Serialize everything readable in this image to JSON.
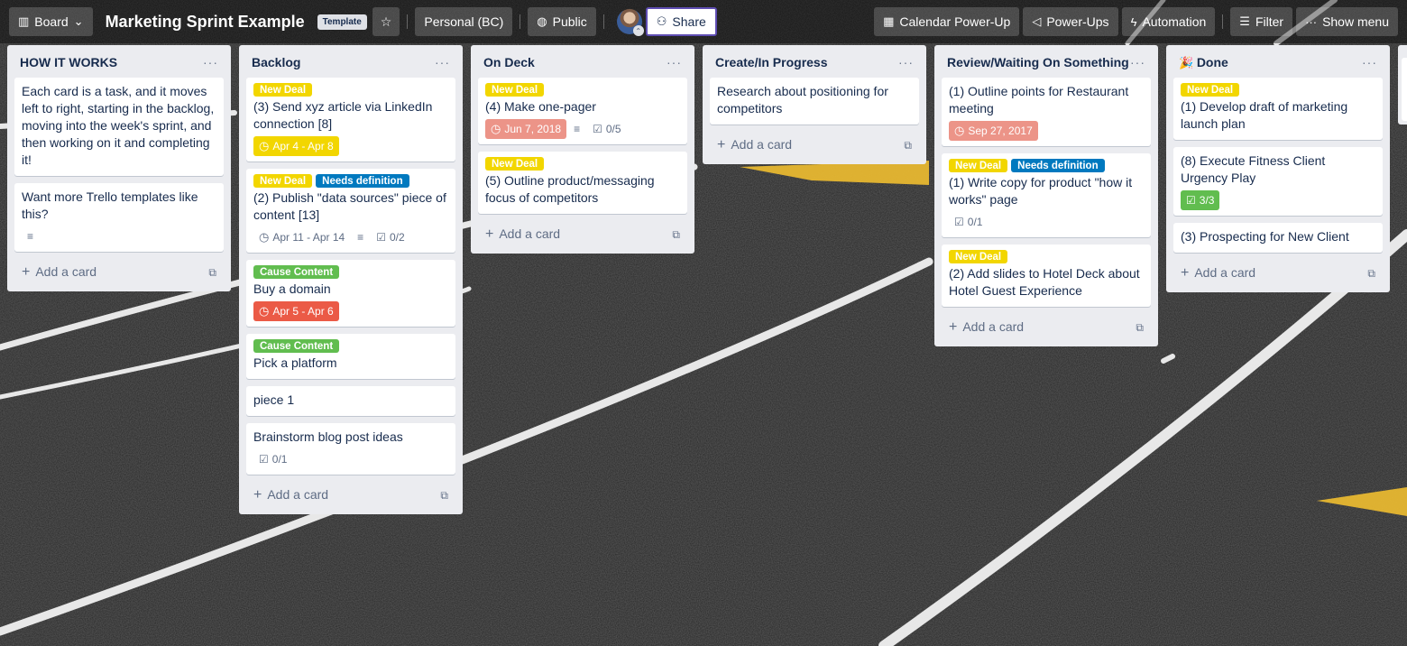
{
  "header": {
    "view_switcher": {
      "icon": "board-icon",
      "label": "Board",
      "chevron": "chevron-down-icon"
    },
    "board_title": "Marketing Sprint Example",
    "template_badge": "Template",
    "star_icon": "star-icon",
    "workspace": "Personal (BC)",
    "visibility": {
      "icon": "globe-icon",
      "label": "Public"
    },
    "share": {
      "icon": "add-member-icon",
      "label": "Share"
    },
    "right_buttons": [
      {
        "name": "calendar-power-up-button",
        "icon": "calendar-icon",
        "glyph": "▦",
        "label": "Calendar Power-Up"
      },
      {
        "name": "power-ups-button",
        "icon": "rocket-icon",
        "glyph": "◁",
        "label": "Power-Ups"
      },
      {
        "name": "automation-button",
        "icon": "lightning-icon",
        "glyph": "ϟ",
        "label": "Automation"
      },
      {
        "name": "filter-button",
        "icon": "filter-icon",
        "glyph": "☰",
        "label": "Filter"
      },
      {
        "name": "show-menu-button",
        "icon": "more-icon",
        "glyph": "···",
        "label": "Show menu"
      }
    ]
  },
  "lists": [
    {
      "title": "HOW IT WORKS",
      "cards": [
        {
          "labels": [],
          "title": "Each card is a task, and it moves left to right, starting in the backlog, moving into the week's sprint, and then working on it and completing it!",
          "badges": []
        },
        {
          "labels": [],
          "title": "Want more Trello templates like this?",
          "badges": [
            {
              "type": "description"
            }
          ]
        }
      ],
      "add_label": "Add a card"
    },
    {
      "title": "Backlog",
      "cards": [
        {
          "labels": [
            {
              "text": "New Deal",
              "color": "yellow"
            }
          ],
          "title": "(3) Send xyz article via LinkedIn connection [8]",
          "badges": [
            {
              "type": "due",
              "text": "Apr 4 - Apr 8",
              "style": "yellow"
            }
          ]
        },
        {
          "labels": [
            {
              "text": "New Deal",
              "color": "yellow"
            },
            {
              "text": "Needs definition",
              "color": "blue"
            }
          ],
          "title": "(2) Publish \"data sources\" piece of content [13]",
          "badges": [
            {
              "type": "due",
              "text": "Apr 11 - Apr 14",
              "style": "plain"
            },
            {
              "type": "description"
            },
            {
              "type": "checklist",
              "text": "0/2"
            }
          ]
        },
        {
          "labels": [
            {
              "text": "Cause Content",
              "color": "green"
            }
          ],
          "title": "Buy a domain",
          "badges": [
            {
              "type": "due",
              "text": "Apr 5 - Apr 6",
              "style": "red"
            }
          ]
        },
        {
          "labels": [
            {
              "text": "Cause Content",
              "color": "green"
            }
          ],
          "title": "Pick a platform",
          "badges": []
        },
        {
          "labels": [],
          "title": "piece 1",
          "badges": []
        },
        {
          "labels": [],
          "title": "Brainstorm blog post ideas",
          "badges": [
            {
              "type": "checklist",
              "text": "0/1"
            }
          ]
        }
      ],
      "add_label": "Add a card"
    },
    {
      "title": "On Deck",
      "cards": [
        {
          "labels": [
            {
              "text": "New Deal",
              "color": "yellow"
            }
          ],
          "title": "(4) Make one-pager",
          "badges": [
            {
              "type": "due",
              "text": "Jun 7, 2018",
              "style": "salmon"
            },
            {
              "type": "description"
            },
            {
              "type": "checklist",
              "text": "0/5"
            }
          ]
        },
        {
          "labels": [
            {
              "text": "New Deal",
              "color": "yellow"
            }
          ],
          "title": "(5) Outline product/messaging focus of competitors",
          "badges": []
        }
      ],
      "add_label": "Add a card"
    },
    {
      "title": "Create/In Progress",
      "cards": [
        {
          "labels": [],
          "title": "Research about positioning for competitors",
          "badges": []
        }
      ],
      "add_label": "Add a card"
    },
    {
      "title": "Review/Waiting On Something",
      "cards": [
        {
          "labels": [],
          "title": "(1) Outline points for Restaurant meeting",
          "badges": [
            {
              "type": "due",
              "text": "Sep 27, 2017",
              "style": "salmon"
            }
          ]
        },
        {
          "labels": [
            {
              "text": "New Deal",
              "color": "yellow"
            },
            {
              "text": "Needs definition",
              "color": "blue"
            }
          ],
          "title": "(1) Write copy for product \"how it works\" page",
          "badges": [
            {
              "type": "checklist",
              "text": "0/1"
            }
          ]
        },
        {
          "labels": [
            {
              "text": "New Deal",
              "color": "yellow"
            }
          ],
          "title": "(2) Add slides to Hotel Deck about Hotel Guest Experience",
          "badges": []
        }
      ],
      "add_label": "Add a card"
    },
    {
      "title": "Done",
      "emoji": "🎉",
      "cards": [
        {
          "labels": [
            {
              "text": "New Deal",
              "color": "yellow"
            }
          ],
          "title": "(1) Develop draft of marketing launch plan",
          "badges": []
        },
        {
          "labels": [],
          "title": "(8) Execute Fitness Client Urgency Play",
          "badges": [
            {
              "type": "checklist",
              "text": "3/3",
              "style": "complete"
            }
          ]
        },
        {
          "labels": [],
          "title": "(3) Prospecting for New Client",
          "badges": []
        }
      ],
      "add_label": "Add a card"
    }
  ],
  "list_menu_glyph": "···",
  "colors": {
    "label_yellow": "#f2d600",
    "label_blue": "#0079bf",
    "label_green": "#61bd4f",
    "due_red": "#eb5a46",
    "due_salmon": "#ec9488",
    "share_border": "#5e4db2",
    "list_bg": "#ebecf0"
  }
}
